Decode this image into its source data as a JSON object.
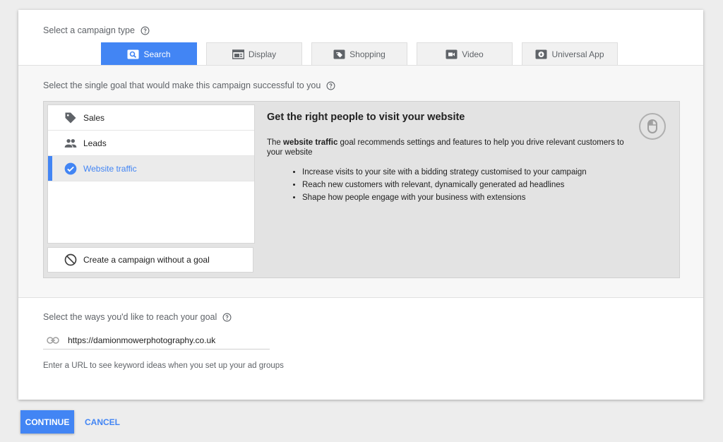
{
  "campaign_type": {
    "label": "Select a campaign type",
    "tabs": [
      {
        "label": "Search",
        "icon": "search-icon",
        "active": true
      },
      {
        "label": "Display",
        "icon": "display-icon",
        "active": false
      },
      {
        "label": "Shopping",
        "icon": "shopping-tag-icon",
        "active": false
      },
      {
        "label": "Video",
        "icon": "video-icon",
        "active": false
      },
      {
        "label": "Universal App",
        "icon": "app-icon",
        "active": false
      }
    ]
  },
  "goal": {
    "label": "Select the single goal that would make this campaign successful to you",
    "items": [
      {
        "label": "Sales",
        "icon": "tag-icon",
        "selected": false
      },
      {
        "label": "Leads",
        "icon": "people-icon",
        "selected": false
      },
      {
        "label": "Website traffic",
        "icon": "check-circle-icon",
        "selected": true
      }
    ],
    "no_goal": {
      "label": "Create a campaign without a goal",
      "icon": "no-entry-icon"
    },
    "detail": {
      "title": "Get the right people to visit your website",
      "desc_prefix": "The ",
      "desc_bold": "website traffic",
      "desc_suffix": " goal recommends settings and features to help you drive relevant customers to your website",
      "bullets": [
        "Increase visits to your site with a bidding strategy customised to your campaign",
        "Reach new customers with relevant, dynamically generated ad headlines",
        "Shape how people engage with your business with extensions"
      ],
      "badge_icon": "mouse-icon"
    }
  },
  "reach": {
    "label": "Select the ways you'd like to reach your goal",
    "url_value": "https://damionmowerphotography.co.uk",
    "hint": "Enter a URL to see keyword ideas when you set up your ad groups"
  },
  "actions": {
    "continue_label": "CONTINUE",
    "cancel_label": "CANCEL"
  },
  "colors": {
    "accent": "#4285f4",
    "background": "#ededed"
  }
}
